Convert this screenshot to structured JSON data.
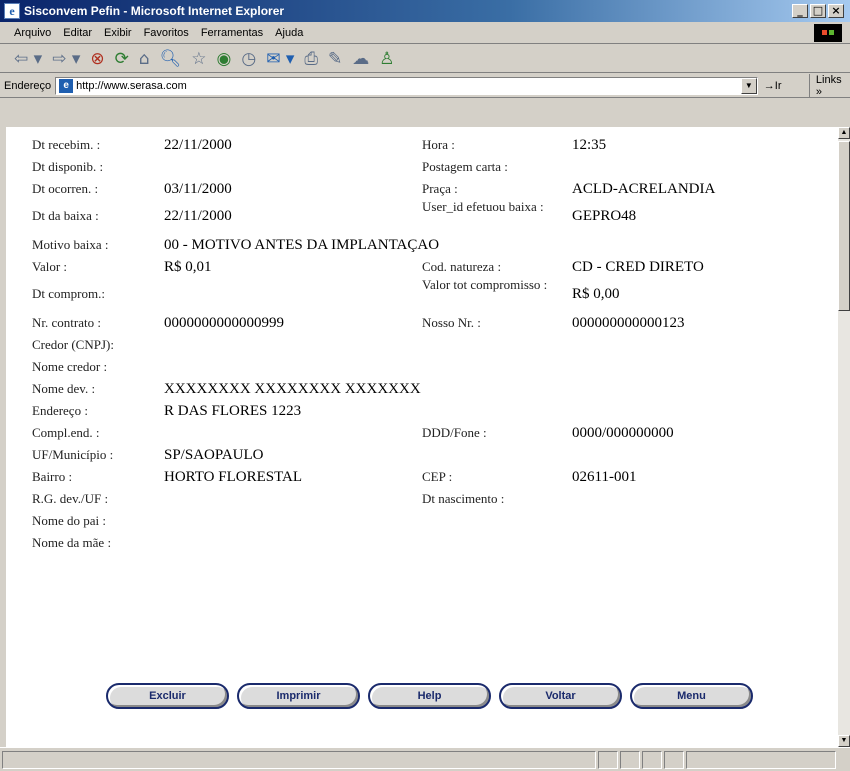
{
  "window": {
    "title": "Sisconvem Pefin - Microsoft Internet Explorer"
  },
  "menu": [
    "Arquivo",
    "Editar",
    "Exibir",
    "Favoritos",
    "Ferramentas",
    "Ajuda"
  ],
  "address": {
    "label": "Endereço",
    "url": "http://www.serasa.com",
    "go_label": "Ir",
    "links_label": "Links »"
  },
  "record": {
    "row1": {
      "l1": "Dt recebim. :",
      "v1": "22/11/2000",
      "l2": "Hora :",
      "v2": "12:35"
    },
    "row2": {
      "l1": "Dt disponib. :",
      "v1": "",
      "l2": "Postagem carta :",
      "v2": ""
    },
    "row3": {
      "l1": "Dt ocorren. :",
      "v1": "03/11/2000",
      "l2": "Praça :",
      "v2": "ACLD-ACRELANDIA"
    },
    "row4": {
      "l1": "Dt da baixa :",
      "v1": "22/11/2000",
      "l2": "User_id efetuou baixa :",
      "v2": "GEPRO48"
    },
    "row5": {
      "l1": "Motivo baixa :",
      "v1": "00 - MOTIVO ANTES DA IMPLANTAÇAO",
      "l2": "",
      "v2": ""
    },
    "row6": {
      "l1": "Valor :",
      "v1": "R$ 0,01",
      "l2": "Cod. natureza :",
      "v2": "CD - CRED DIRETO"
    },
    "row7": {
      "l1": "Dt comprom.:",
      "v1": "",
      "l2": "Valor tot compromisso :",
      "v2": "R$ 0,00"
    },
    "row8": {
      "l1": "Nr. contrato :",
      "v1": "0000000000000999",
      "l2": "Nosso Nr. :",
      "v2": "000000000000123"
    },
    "row9": {
      "l1": "Credor (CNPJ):",
      "v1": "",
      "l2": "",
      "v2": ""
    },
    "row10": {
      "l1": "Nome credor :",
      "v1": "",
      "l2": "",
      "v2": ""
    },
    "row11": {
      "l1": "Nome dev. :",
      "v1": "XXXXXXXX XXXXXXXX XXXXXXX",
      "l2": "",
      "v2": ""
    },
    "row12": {
      "l1": "Endereço :",
      "v1": "R DAS FLORES 1223",
      "l2": "",
      "v2": ""
    },
    "row13": {
      "l1": "Compl.end. :",
      "v1": "",
      "l2": "DDD/Fone :",
      "v2": "0000/000000000"
    },
    "row14": {
      "l1": "UF/Município :",
      "v1": "SP/SAOPAULO",
      "l2": "",
      "v2": ""
    },
    "row15": {
      "l1": "Bairro :",
      "v1": "HORTO FLORESTAL",
      "l2": "CEP :",
      "v2": "02611-001"
    },
    "row16": {
      "l1": "R.G. dev./UF :",
      "v1": "",
      "l2": "Dt nascimento :",
      "v2": ""
    },
    "row17": {
      "l1": "Nome do pai :",
      "v1": "",
      "l2": "",
      "v2": ""
    },
    "row18": {
      "l1": "Nome da mãe :",
      "v1": "",
      "l2": "",
      "v2": ""
    }
  },
  "buttons": {
    "excluir": "Excluir",
    "imprimir": "Imprimir",
    "help": "Help",
    "voltar": "Voltar",
    "menu": "Menu"
  }
}
